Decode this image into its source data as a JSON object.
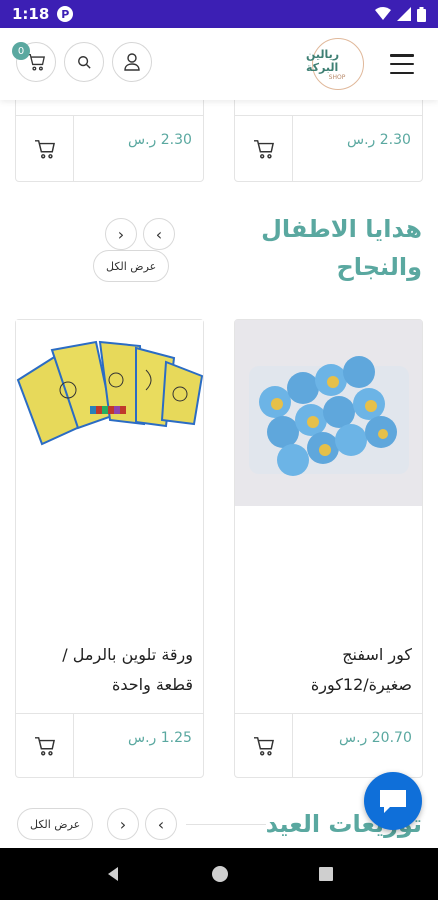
{
  "status_bar": {
    "time": "1:18",
    "notification_badge": "P"
  },
  "header": {
    "cart_count": "0",
    "logo_name": "ريالين البركة",
    "logo_sub": "SHOP"
  },
  "top_row": {
    "left_price": "2.30 ر.س",
    "right_price": "2.30 ر.س"
  },
  "section1": {
    "title_line1": "هدايا الاطفال",
    "title_line2": "والنجاح",
    "view_all": "عرض الكل",
    "prev": "‹",
    "next": "›",
    "products": [
      {
        "name_line1": "كور اسفنج",
        "name_line2": "صغيرة/12كورة",
        "price": "20.70 ر.س"
      },
      {
        "name_line1": "ورقة تلوين بالرمل /",
        "name_line2": "قطعة واحدة",
        "price": "1.25 ر.س"
      }
    ]
  },
  "section2": {
    "title": "توزيعات العيد",
    "view_all": "عرض الكل",
    "prev": "‹",
    "next": "›"
  },
  "colors": {
    "accent": "#5aa8a0",
    "status_bar": "#3c1fb4",
    "chat_fab": "#0f6fd9"
  }
}
